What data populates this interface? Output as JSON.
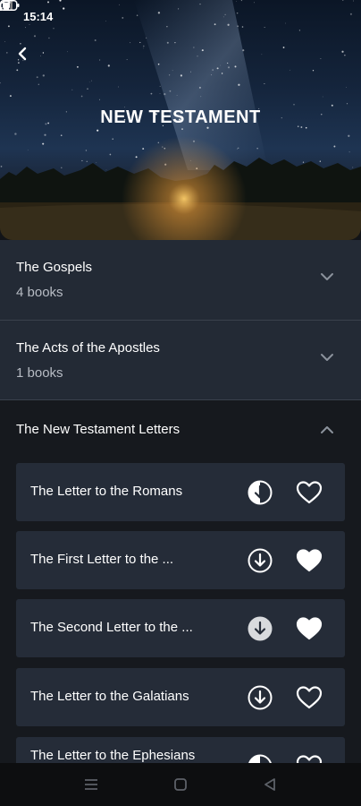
{
  "status_bar": {
    "time": "15:14"
  },
  "header": {
    "title": "NEW TESTAMENT"
  },
  "sections": [
    {
      "title": "The Gospels",
      "subtitle": "4 books",
      "expanded": false
    },
    {
      "title": "The Acts of the Apostles",
      "subtitle": "1 books",
      "expanded": false
    },
    {
      "title": "The New Testament Letters",
      "expanded": true
    }
  ],
  "books": [
    {
      "title": "The Letter to the Romans",
      "download_state": "partial",
      "favorite": false
    },
    {
      "title": "The First Letter to the ...",
      "download_state": "available",
      "favorite": true
    },
    {
      "title": "The Second Letter to the ...",
      "download_state": "downloaded",
      "favorite": true
    },
    {
      "title": "The Letter to the Galatians",
      "download_state": "available",
      "favorite": false
    },
    {
      "title": "The Letter to the Ephesians",
      "download_state": "partial",
      "favorite": false
    }
  ],
  "icons": {
    "back": "chevron-left-icon",
    "collapsed": "chevron-down-icon",
    "expanded": "chevron-up-icon",
    "download": "download-icon",
    "favorite": "heart-icon",
    "nav": [
      "menu-icon",
      "home-icon",
      "back-icon"
    ]
  },
  "colors": {
    "background": "#121418",
    "section": "#232a35",
    "card": "#252c38",
    "text": "#ffffff",
    "subtext": "#b7bcc4"
  }
}
